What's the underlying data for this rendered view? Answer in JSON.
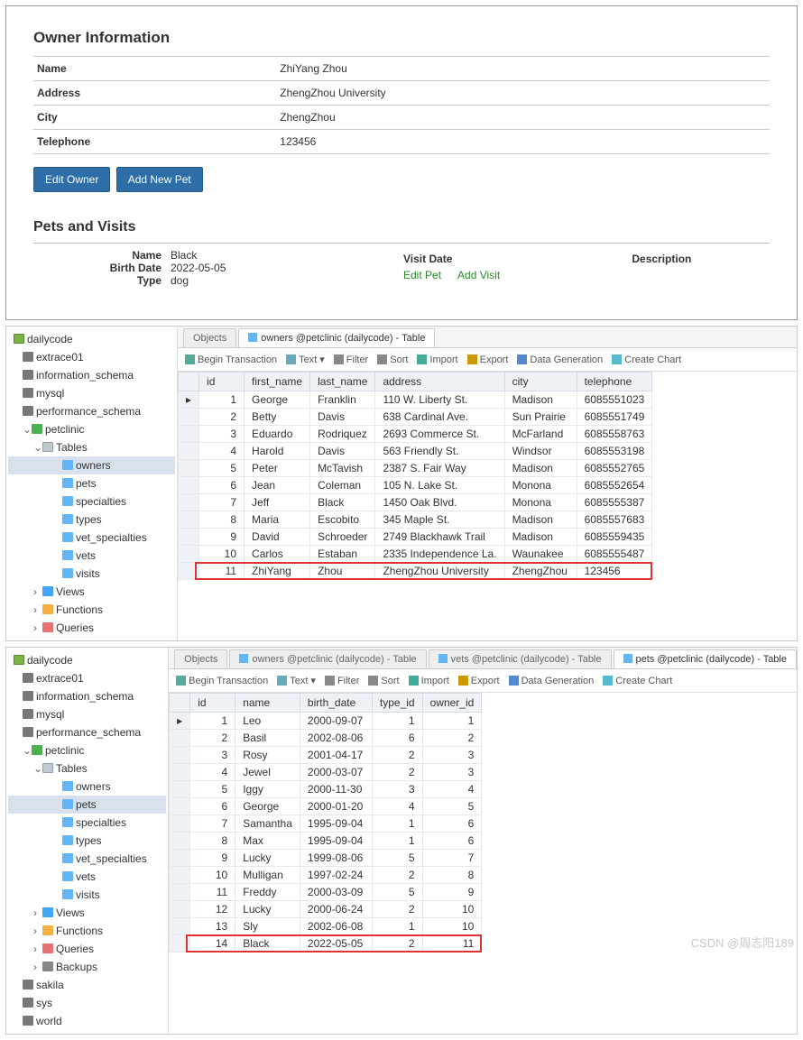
{
  "owner_info": {
    "heading": "Owner Information",
    "rows": [
      {
        "label": "Name",
        "value": "ZhiYang Zhou"
      },
      {
        "label": "Address",
        "value": "ZhengZhou University"
      },
      {
        "label": "City",
        "value": "ZhengZhou"
      },
      {
        "label": "Telephone",
        "value": "123456"
      }
    ],
    "edit_btn": "Edit Owner",
    "add_btn": "Add New Pet"
  },
  "pets": {
    "heading": "Pets and Visits",
    "name_lbl": "Name",
    "name_val": "Black",
    "bd_lbl": "Birth Date",
    "bd_val": "2022-05-05",
    "type_lbl": "Type",
    "type_val": "dog",
    "vd_lbl": "Visit Date",
    "desc_lbl": "Description",
    "edit_pet": "Edit Pet",
    "add_visit": "Add Visit"
  },
  "tree_common": {
    "conn": "dailycode",
    "dbs": [
      "extrace01",
      "information_schema",
      "mysql",
      "performance_schema"
    ],
    "petclinic": "petclinic",
    "tables_lbl": "Tables",
    "tables": [
      "owners",
      "pets",
      "specialties",
      "types",
      "vet_specialties",
      "vets",
      "visits"
    ],
    "views": "Views",
    "functions": "Functions",
    "queries": "Queries",
    "backups": "Backups",
    "extra_dbs": [
      "sakila",
      "sys",
      "world"
    ]
  },
  "panel_owners": {
    "tabs": {
      "objects": "Objects",
      "owners": "owners @petclinic (dailycode) - Table"
    },
    "toolbar": {
      "begin": "Begin Transaction",
      "text": "Text",
      "filter": "Filter",
      "sort": "Sort",
      "import": "Import",
      "export": "Export",
      "datagen": "Data Generation",
      "chart": "Create Chart"
    },
    "cols": [
      "id",
      "first_name",
      "last_name",
      "address",
      "city",
      "telephone"
    ],
    "rows": [
      [
        "1",
        "George",
        "Franklin",
        "110 W. Liberty St.",
        "Madison",
        "6085551023"
      ],
      [
        "2",
        "Betty",
        "Davis",
        "638 Cardinal Ave.",
        "Sun Prairie",
        "6085551749"
      ],
      [
        "3",
        "Eduardo",
        "Rodriquez",
        "2693 Commerce St.",
        "McFarland",
        "6085558763"
      ],
      [
        "4",
        "Harold",
        "Davis",
        "563 Friendly St.",
        "Windsor",
        "6085553198"
      ],
      [
        "5",
        "Peter",
        "McTavish",
        "2387 S. Fair Way",
        "Madison",
        "6085552765"
      ],
      [
        "6",
        "Jean",
        "Coleman",
        "105 N. Lake St.",
        "Monona",
        "6085552654"
      ],
      [
        "7",
        "Jeff",
        "Black",
        "1450 Oak Blvd.",
        "Monona",
        "6085555387"
      ],
      [
        "8",
        "Maria",
        "Escobito",
        "345 Maple St.",
        "Madison",
        "6085557683"
      ],
      [
        "9",
        "David",
        "Schroeder",
        "2749 Blackhawk Trail",
        "Madison",
        "6085559435"
      ],
      [
        "10",
        "Carlos",
        "Estaban",
        "2335 Independence La.",
        "Waunakee",
        "6085555487"
      ],
      [
        "11",
        "ZhiYang",
        "Zhou",
        "ZhengZhou University",
        "ZhengZhou",
        "123456"
      ]
    ],
    "highlight_index": 10
  },
  "panel_pets": {
    "tabs": {
      "objects": "Objects",
      "owners": "owners @petclinic (dailycode) - Table",
      "vets": "vets @petclinic (dailycode) - Table",
      "pets": "pets @petclinic (dailycode) - Table"
    },
    "toolbar": {
      "begin": "Begin Transaction",
      "text": "Text",
      "filter": "Filter",
      "sort": "Sort",
      "import": "Import",
      "export": "Export",
      "datagen": "Data Generation",
      "chart": "Create Chart"
    },
    "cols": [
      "id",
      "name",
      "birth_date",
      "type_id",
      "owner_id"
    ],
    "rows": [
      [
        "1",
        "Leo",
        "2000-09-07",
        "1",
        "1"
      ],
      [
        "2",
        "Basil",
        "2002-08-06",
        "6",
        "2"
      ],
      [
        "3",
        "Rosy",
        "2001-04-17",
        "2",
        "3"
      ],
      [
        "4",
        "Jewel",
        "2000-03-07",
        "2",
        "3"
      ],
      [
        "5",
        "Iggy",
        "2000-11-30",
        "3",
        "4"
      ],
      [
        "6",
        "George",
        "2000-01-20",
        "4",
        "5"
      ],
      [
        "7",
        "Samantha",
        "1995-09-04",
        "1",
        "6"
      ],
      [
        "8",
        "Max",
        "1995-09-04",
        "1",
        "6"
      ],
      [
        "9",
        "Lucky",
        "1999-08-06",
        "5",
        "7"
      ],
      [
        "10",
        "Mulligan",
        "1997-02-24",
        "2",
        "8"
      ],
      [
        "11",
        "Freddy",
        "2000-03-09",
        "5",
        "9"
      ],
      [
        "12",
        "Lucky",
        "2000-06-24",
        "2",
        "10"
      ],
      [
        "13",
        "Sly",
        "2002-06-08",
        "1",
        "10"
      ],
      [
        "14",
        "Black",
        "2022-05-05",
        "2",
        "11"
      ]
    ],
    "highlight_index": 13
  },
  "watermark": "CSDN @周志阳189"
}
